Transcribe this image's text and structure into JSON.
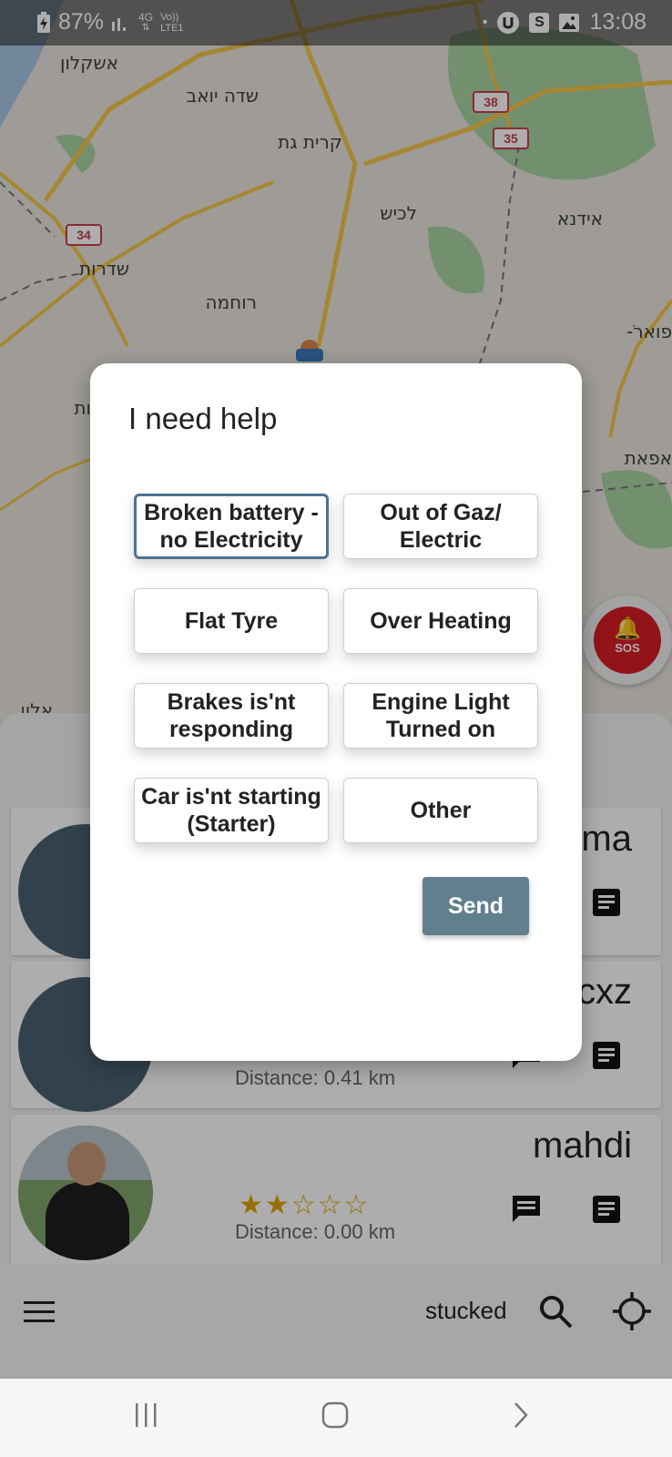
{
  "status_bar": {
    "battery": "87%",
    "network": "4G",
    "volte": "Vo)) LTE1",
    "time": "13:08",
    "icons": [
      "battery-charging-icon",
      "signal-icon",
      "vpn-icon",
      "s-app-icon",
      "gallery-icon"
    ]
  },
  "map": {
    "places": [
      "אשקלון",
      "שדה יואב",
      "קרית גת",
      "לכיש",
      "אידנא",
      "שדרות",
      "רוחמה",
      "פוארֹ-",
      "אפאת",
      "ות",
      "אלון"
    ],
    "routes": [
      "38",
      "35",
      "34"
    ]
  },
  "sos": {
    "label": "SOS",
    "color": "#d81e26"
  },
  "dialog": {
    "title": "I need help",
    "options": [
      {
        "label": "Broken battery - no Electricity",
        "selected": true
      },
      {
        "label": "Out of Gaz/ Electric",
        "selected": false
      },
      {
        "label": "Flat Tyre",
        "selected": false
      },
      {
        "label": "Over Heating",
        "selected": false
      },
      {
        "label": "Brakes is'nt responding",
        "selected": false
      },
      {
        "label": "Engine Light Turned on",
        "selected": false
      },
      {
        "label": "Car is'nt starting (Starter)",
        "selected": false
      },
      {
        "label": "Other",
        "selected": false
      }
    ],
    "send_label": "Send",
    "accent": "#4b7393",
    "send_color": "#627f8e"
  },
  "providers": [
    {
      "name": "ama",
      "rating_stars": "",
      "distance": ""
    },
    {
      "name": "cxz",
      "rating_stars": "☆☆☆☆☆",
      "distance": "Distance: 0.41 km"
    },
    {
      "name": "mahdi",
      "rating_stars": "★★☆☆☆",
      "distance": "Distance: 0.00 km"
    }
  ],
  "app_bar": {
    "status_text": "stucked"
  },
  "nav_bar": {
    "recents": "|||",
    "home": "○",
    "back": "›"
  }
}
